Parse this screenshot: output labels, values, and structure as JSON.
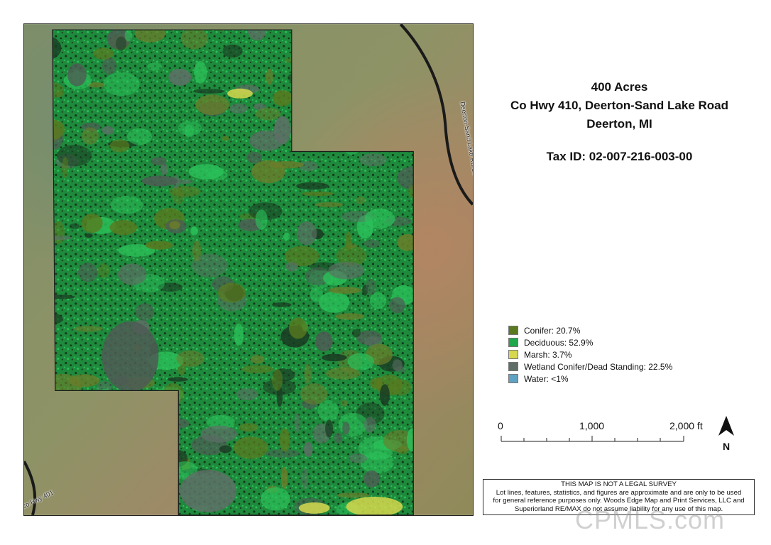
{
  "title": {
    "line1": "400 Acres",
    "line2": "Co Hwy 410, Deerton-Sand Lake Road",
    "line3": "Deerton, MI",
    "tax_id": "Tax ID: 02-007-216-003-00"
  },
  "roads": {
    "deerton_sand_lake": "Deerton-Sand Lake Rd/Co Hwy 401",
    "co_hwy": "Co Hwy 401"
  },
  "legend": [
    {
      "label": "Conifer: 20.7%",
      "color": "#5a7a1f",
      "name": "conifer"
    },
    {
      "label": "Deciduous: 52.9%",
      "color": "#1fa84a",
      "name": "deciduous"
    },
    {
      "label": "Marsh: 3.7%",
      "color": "#d6d84e",
      "name": "marsh"
    },
    {
      "label": "Wetland Conifer/Dead Standing: 22.5%",
      "color": "#5e6e66",
      "name": "wetland"
    },
    {
      "label": "Water: <1%",
      "color": "#5ea2c4",
      "name": "water"
    }
  ],
  "scale": {
    "labels": [
      "0",
      "1,000",
      "2,000 ft"
    ]
  },
  "north": {
    "label": "N"
  },
  "disclaimer": {
    "line1": "THIS MAP IS NOT A LEGAL SURVEY",
    "line2": "Lot lines, features, statistics, and figures are approximate and are only to be used",
    "line3": "for general reference purposes only. Woods Edge Map and Print Services, LLC and",
    "line4": "Superiorland RE/MAX do not assume liability for any use of this map."
  },
  "watermark": "CPMLS.com",
  "colors": {
    "terrain_base": "#7e8a5e",
    "terrain_east": "#a58a66",
    "road": "#1a1a1a",
    "parcel_base": "#2a3a22"
  }
}
